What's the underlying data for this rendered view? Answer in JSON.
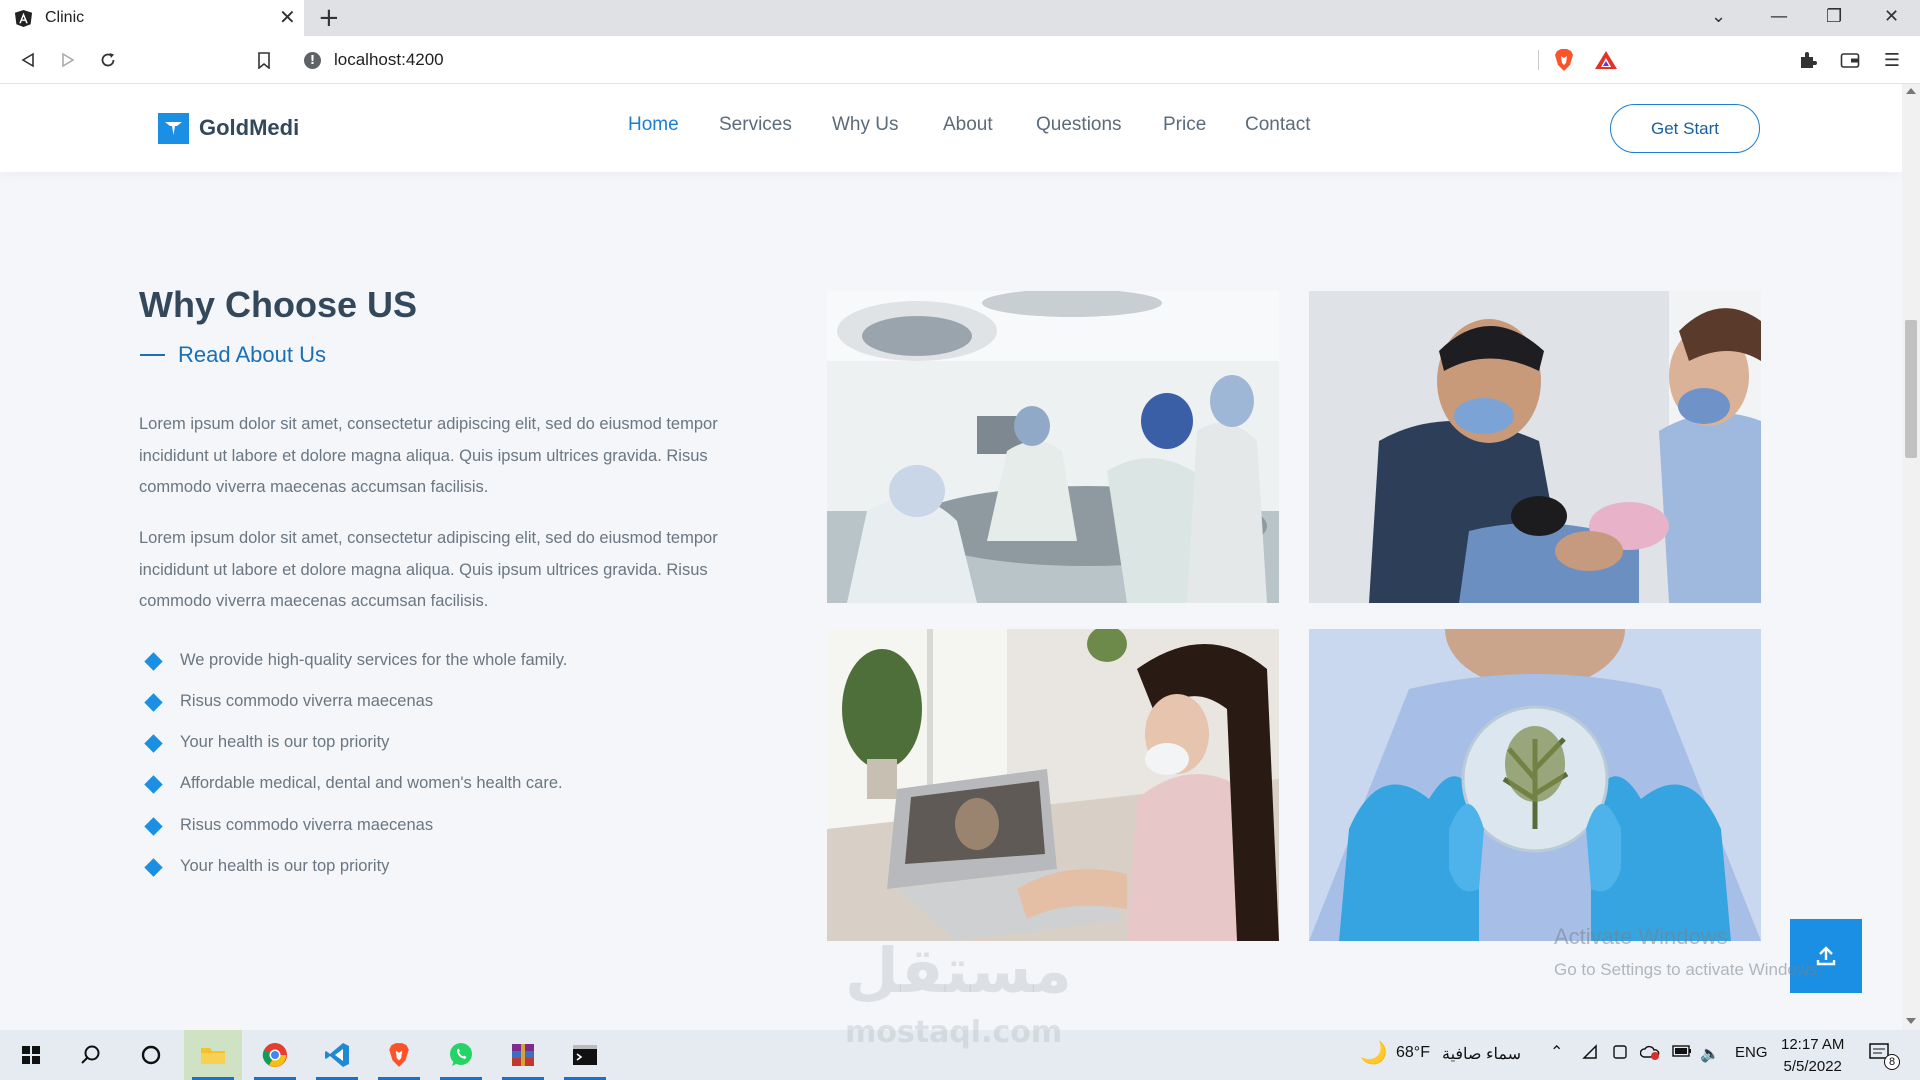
{
  "browser": {
    "tab_title": "Clinic",
    "url": "localhost:4200"
  },
  "site": {
    "brand": "GoldMedi",
    "nav": [
      "Home",
      "Services",
      "Why Us",
      "About",
      "Questions",
      "Price",
      "Contact"
    ],
    "active_nav": "Home",
    "cta": "Get Start"
  },
  "section": {
    "title": "Why Choose US",
    "subtitle": "Read About Us",
    "paragraphs": [
      "Lorem ipsum dolor sit amet, consectetur adipiscing elit, sed do eiusmod tempor incididunt ut labore et dolore magna aliqua. Quis ipsum ultrices gravida. Risus commodo viverra maecenas accumsan facilisis.",
      "Lorem ipsum dolor sit amet, consectetur adipiscing elit, sed do eiusmod tempor incididunt ut labore et dolore magna aliqua. Quis ipsum ultrices gravida. Risus commodo viverra maecenas accumsan facilisis."
    ],
    "features": [
      "We provide high-quality services for the whole family.",
      "Risus commodo viverra maecenas",
      "Your health is our top priority",
      "Affordable medical, dental and women's health care.",
      "Risus commodo viverra maecenas",
      "Your health is our top priority"
    ],
    "photos": [
      "surgery-team-photo",
      "dentist-photo",
      "telemedicine-laptop-photo",
      "lab-petri-dish-photo"
    ]
  },
  "watermark": {
    "activate": "Activate Windows",
    "goto": "Go to Settings to activate Windows.",
    "brand_ar": "مستقل",
    "brand_en": "mostaql.com"
  },
  "taskbar": {
    "weather_temp": "68°F",
    "weather_text": "سماء صافية",
    "lang": "ENG",
    "time": "12:17 AM",
    "date": "5/5/2022",
    "notif_count": "8"
  },
  "colors": {
    "accent": "#1a8fe3",
    "heading": "#34485c",
    "body_text": "#6a7682"
  }
}
